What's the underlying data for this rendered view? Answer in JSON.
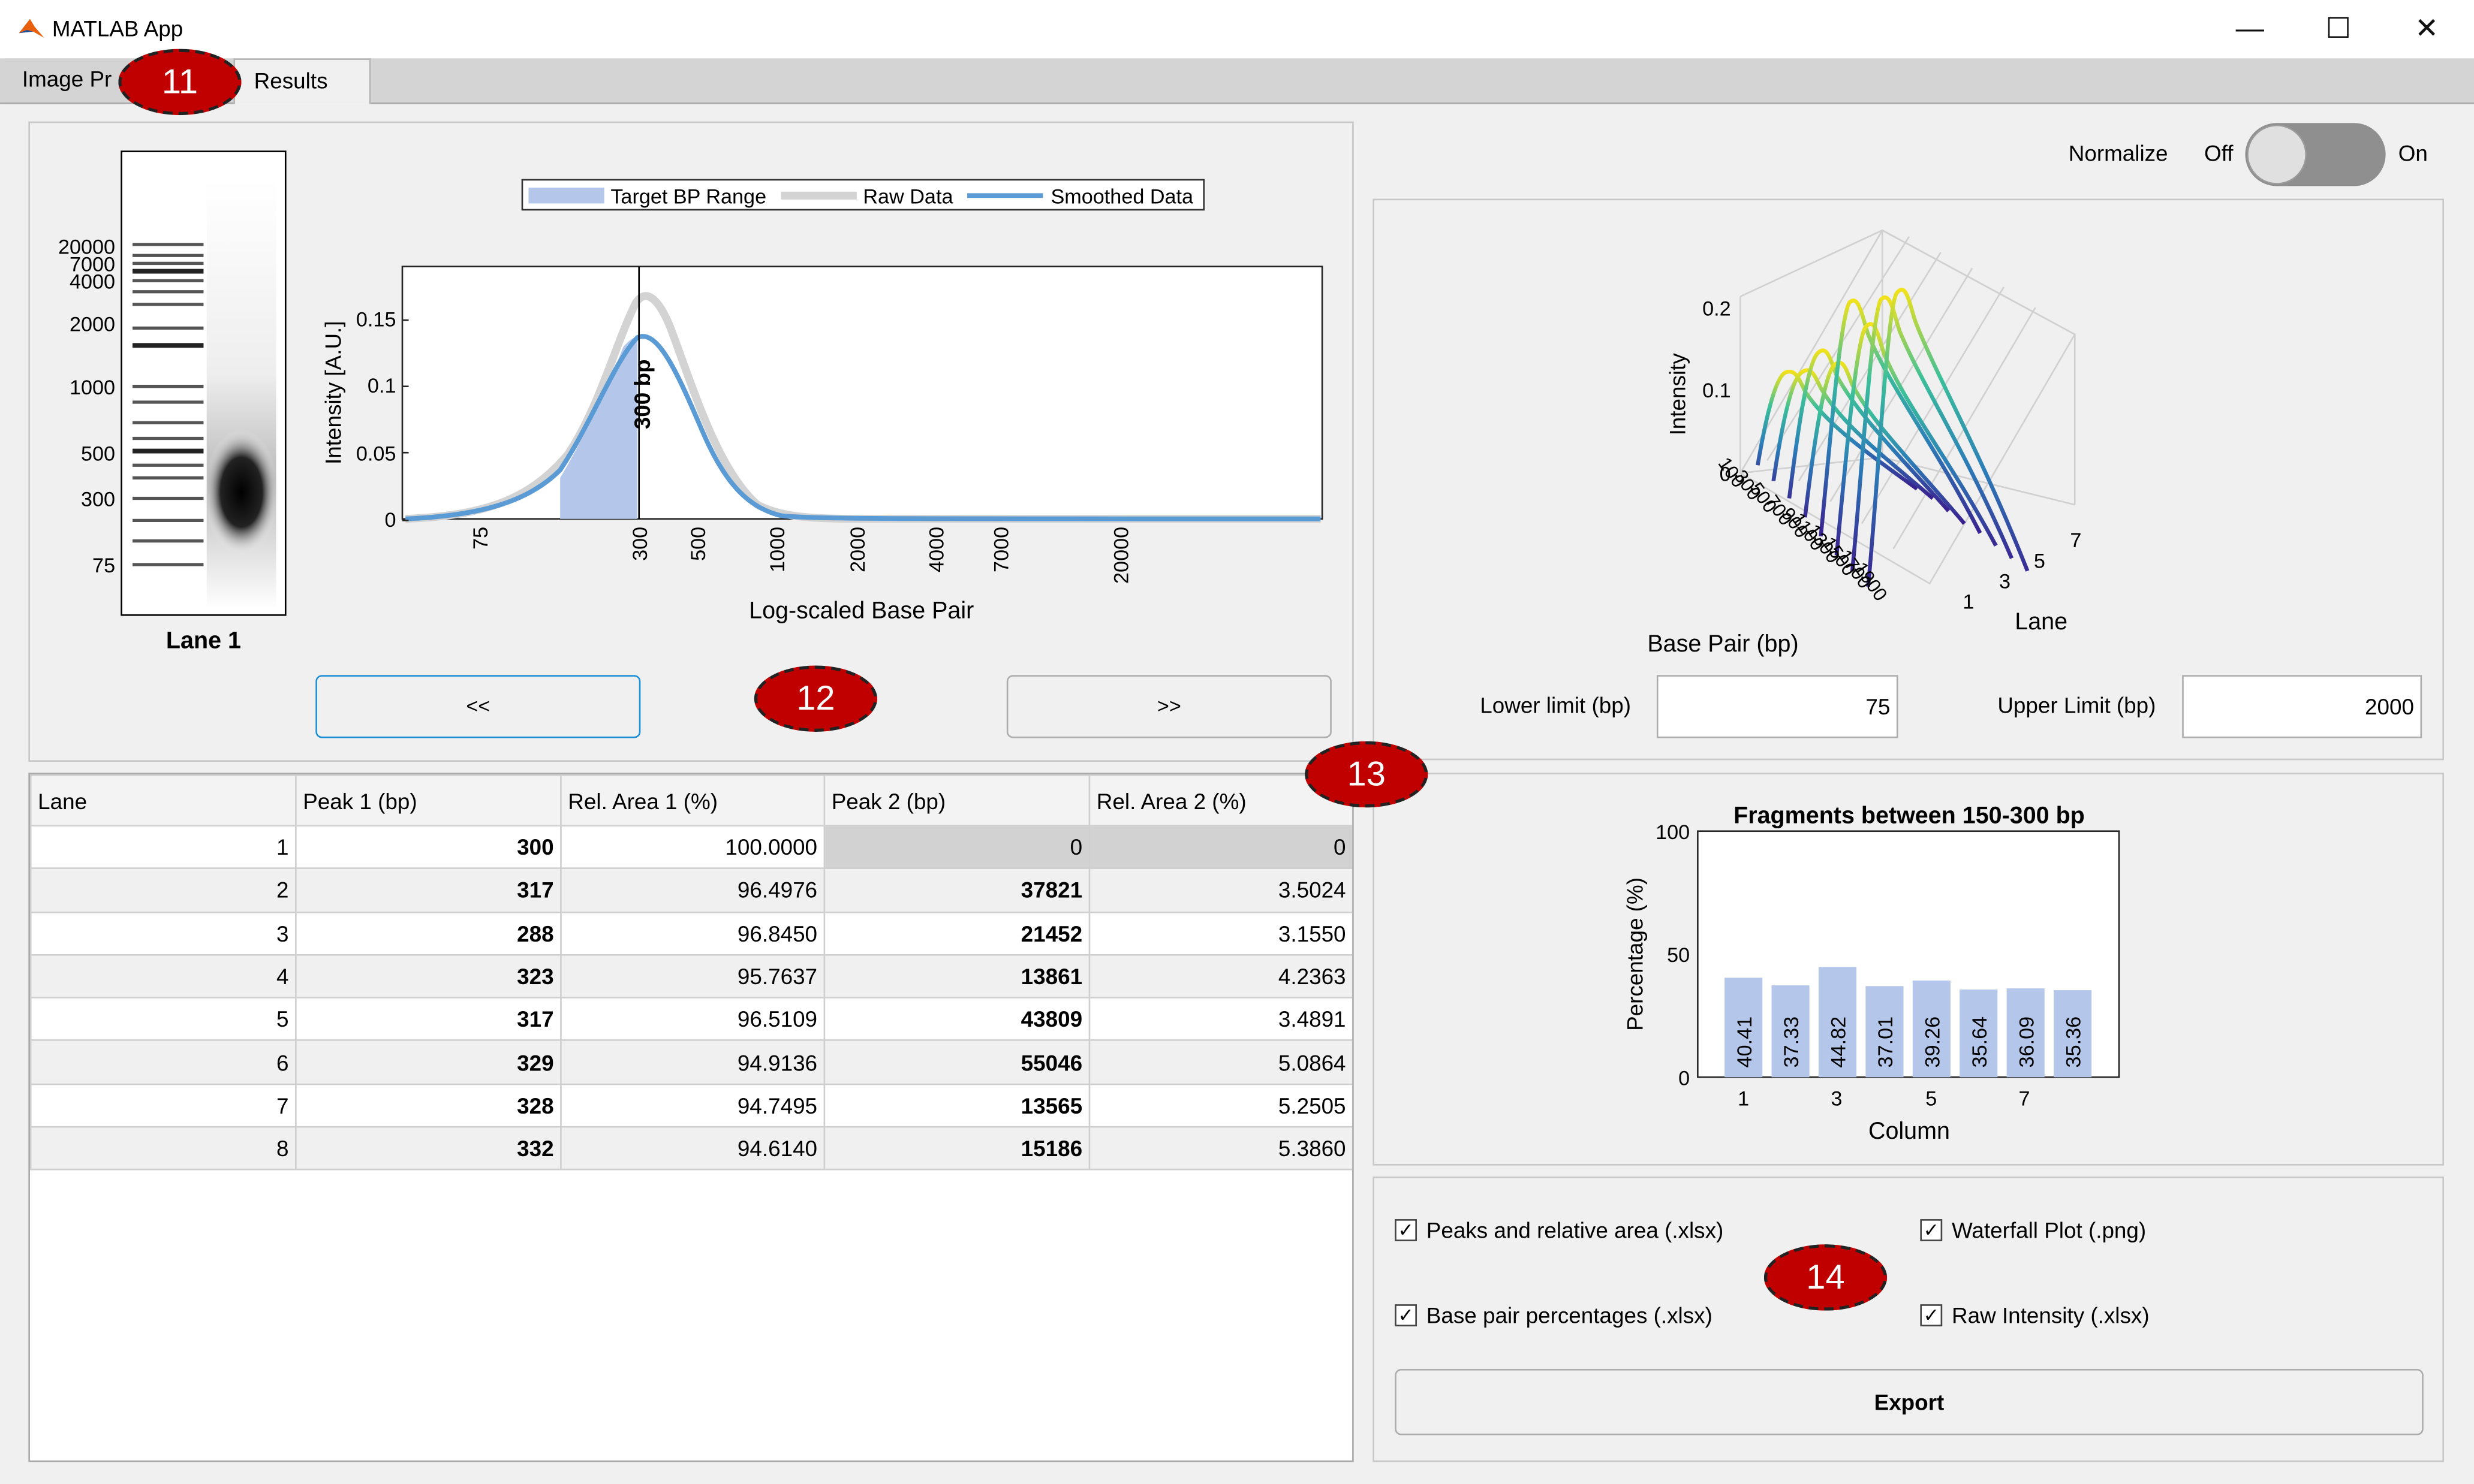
{
  "window": {
    "title": "MATLAB App",
    "minimize_glyph": "—",
    "maximize_glyph": "☐",
    "close_glyph": "✕"
  },
  "tabs": [
    {
      "label": "Image Pr"
    },
    {
      "label": "Results"
    }
  ],
  "badges": [
    "11",
    "12",
    "13",
    "14"
  ],
  "gel": {
    "lane_label": "Lane 1",
    "ladder_labels": [
      "20000",
      "7000",
      "4000",
      "2000",
      "1000",
      "500",
      "300",
      "75"
    ]
  },
  "intensity_chart": {
    "legend": [
      "Target BP Range",
      "Raw Data",
      "Smoothed Data"
    ],
    "ylabel": "Intensity [A.U.]",
    "xlabel": "Log-scaled Base Pair",
    "yticks": [
      "0",
      "0.05",
      "0.1",
      "0.15"
    ],
    "xticks": [
      "75",
      "300",
      "500",
      "1000",
      "2000",
      "4000",
      "7000",
      "20000"
    ],
    "marker_label": "300 bp",
    "colors": {
      "target": "#b4c7ea",
      "raw": "#d3d3d3",
      "smoothed": "#5b9bd5"
    }
  },
  "nav": {
    "prev_label": "<<",
    "next_label": ">>"
  },
  "normalize": {
    "label": "Normalize",
    "off_label": "Off",
    "on_label": "On",
    "state": "off"
  },
  "waterfall": {
    "ylabel": "Intensity",
    "xlabel": "Base Pair (bp)",
    "lane_axis_label": "Lane",
    "z_ticks": [
      "0",
      "0.1",
      "0.2"
    ],
    "bp_ticks": [
      "100",
      "300",
      "500",
      "700",
      "900",
      "1100",
      "1300",
      "1500",
      "1700",
      "1900"
    ],
    "lane_ticks": [
      "1",
      "3",
      "5",
      "7"
    ]
  },
  "limits": {
    "lower_label": "Lower limit (bp)",
    "lower_value": "75",
    "upper_label": "Upper Limit (bp)",
    "upper_value": "2000"
  },
  "table": {
    "headers": [
      "Lane",
      "Peak 1 (bp)",
      "Rel. Area 1 (%)",
      "Peak 2 (bp)",
      "Rel. Area 2 (%)"
    ],
    "rows": [
      [
        "1",
        "300",
        "100.0000",
        "0",
        "0"
      ],
      [
        "2",
        "317",
        "96.4976",
        "37821",
        "3.5024"
      ],
      [
        "3",
        "288",
        "96.8450",
        "21452",
        "3.1550"
      ],
      [
        "4",
        "323",
        "95.7637",
        "13861",
        "4.2363"
      ],
      [
        "5",
        "317",
        "96.5109",
        "43809",
        "3.4891"
      ],
      [
        "6",
        "329",
        "94.9136",
        "55046",
        "5.0864"
      ],
      [
        "7",
        "328",
        "94.7495",
        "13565",
        "5.2505"
      ],
      [
        "8",
        "332",
        "94.6140",
        "15186",
        "5.3860"
      ]
    ]
  },
  "chart_data": [
    {
      "type": "bar",
      "title": "Fragments between 150-300 bp",
      "xlabel": "Column",
      "ylabel": "Percentage (%)",
      "categories": [
        1,
        2,
        3,
        4,
        5,
        6,
        7,
        8
      ],
      "values": [
        40.41,
        37.33,
        44.82,
        37.01,
        39.26,
        35.64,
        36.09,
        35.36
      ],
      "data_labels": [
        "40.41",
        "37.33",
        "44.82",
        "37.01",
        "39.26",
        "35.64",
        "36.09",
        "35.36"
      ],
      "xticks": [
        "1",
        "3",
        "5",
        "7"
      ],
      "yticks": [
        "0",
        "50",
        "100"
      ],
      "ylim": [
        0,
        100
      ],
      "bar_color": "#b4c7ea"
    }
  ],
  "exports": {
    "peaks": {
      "label": "Peaks and relative area (.xlsx)",
      "checked": true
    },
    "waterfall": {
      "label": "Waterfall Plot (.png)",
      "checked": true
    },
    "bp_pct": {
      "label": "Base pair percentages (.xlsx)",
      "checked": true
    },
    "raw": {
      "label": "Raw Intensity (.xlsx)",
      "checked": true
    },
    "check_glyph": "✓",
    "export_label": "Export"
  }
}
